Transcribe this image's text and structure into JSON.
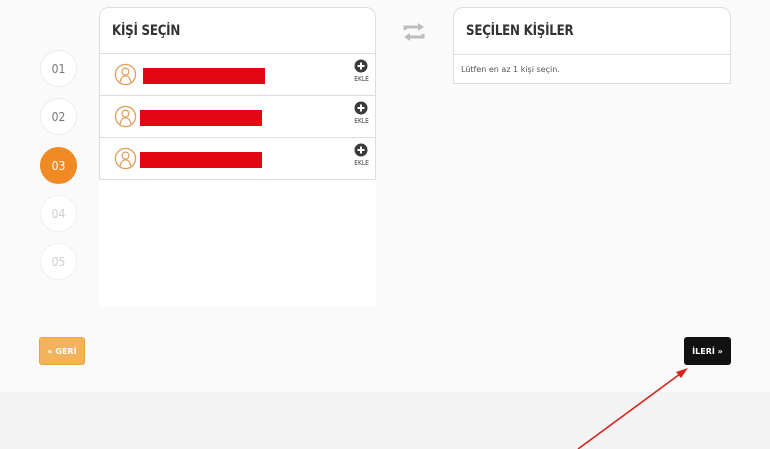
{
  "steps": [
    {
      "label": "01",
      "state": "done"
    },
    {
      "label": "02",
      "state": "done"
    },
    {
      "label": "03",
      "state": "active"
    },
    {
      "label": "04",
      "state": "future"
    },
    {
      "label": "05",
      "state": "future"
    }
  ],
  "select_panel": {
    "title": "KİŞİ SEÇİN",
    "add_label": "EKLE",
    "people": [
      {
        "avatar_icon": "user-avatar-icon",
        "name_redacted": true,
        "add_icon": "plus-circle-icon"
      },
      {
        "avatar_icon": "user-avatar-icon",
        "name_redacted": true,
        "add_icon": "plus-circle-icon"
      },
      {
        "avatar_icon": "user-avatar-icon",
        "name_redacted": true,
        "add_icon": "plus-circle-icon"
      }
    ]
  },
  "swap_icon": "swap-arrows-icon",
  "selected_panel": {
    "title": "SEÇİLEN KİŞİLER",
    "hint": "Lütfen en az 1 kişi seçin."
  },
  "nav": {
    "back_label": "« GERİ",
    "next_label": "İLERİ »"
  },
  "colors": {
    "accent_orange": "#f08a24",
    "back_button": "#f2b35a",
    "next_button": "#111111",
    "redaction": "#e30613",
    "annotation_arrow": "#d9231e"
  }
}
